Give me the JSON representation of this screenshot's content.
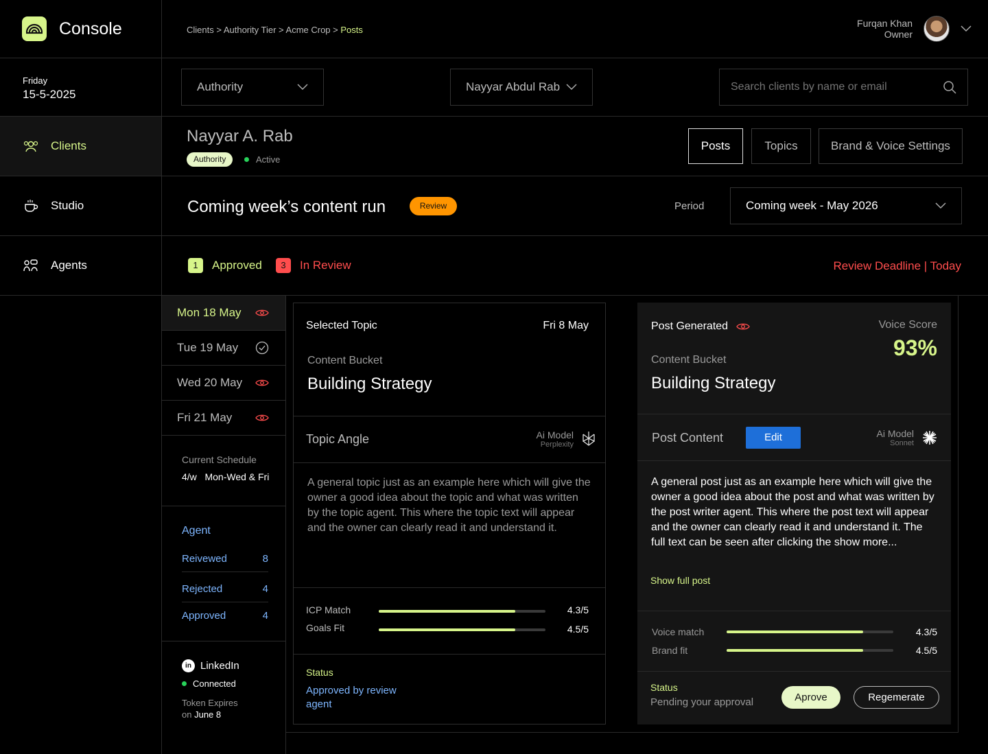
{
  "app": {
    "title": "Console"
  },
  "breadcrumb": {
    "path": "Clients > Authority Tier > Acme Crop  >",
    "current": "Posts"
  },
  "user": {
    "name": "Furqan Khan",
    "role": "Owner"
  },
  "date": {
    "day": "Friday",
    "date": "15-5-2025"
  },
  "nav": {
    "clients": "Clients",
    "studio": "Studio",
    "agents": "Agents"
  },
  "filters": {
    "tier": "Authority",
    "client": "Nayyar Abdul Rab",
    "search_placeholder": "Search clients by name or email"
  },
  "client": {
    "name": "Nayyar A. Rab",
    "tier_badge": "Authority",
    "status": "Active"
  },
  "tabs": {
    "posts": "Posts",
    "topics": "Topics",
    "brand": "Brand & Voice Settings"
  },
  "run": {
    "title": "Coming week’s content run",
    "badge": "Review",
    "period_label": "Period",
    "period_value": "Coming week - May 2026"
  },
  "counts": {
    "approved_num": "1",
    "approved_label": "Approved",
    "review_num": "3",
    "review_label": "In Review",
    "deadline": "Review Deadline | Today"
  },
  "days": [
    {
      "label": "Mon 18 May",
      "icon": "eye-icon"
    },
    {
      "label": "Tue 19 May",
      "icon": "check-circle-icon"
    },
    {
      "label": "Wed 20 May",
      "icon": "eye-icon"
    },
    {
      "label": "Fri 21 May",
      "icon": "eye-icon"
    }
  ],
  "schedule": {
    "label": "Current Schedule",
    "value": "4/w   Mon-Wed & Fri"
  },
  "agent": {
    "title": "Agent",
    "rows": [
      {
        "label": "Reivewed",
        "value": "8"
      },
      {
        "label": "Rejected",
        "value": "4"
      },
      {
        "label": "Approved",
        "value": "4"
      }
    ]
  },
  "linkedin": {
    "name": "LinkedIn",
    "status": "Connected",
    "token_line1": "Token Expires",
    "token_prefix": "on",
    "token_date": "June 8"
  },
  "topic_card": {
    "title": "Selected Topic",
    "date": "Fri 8 May",
    "bucket_label": "Content Bucket",
    "bucket": "Building Strategy",
    "angle_label": "Topic Angle",
    "model_label": "Ai Model",
    "model_name": "Perplexity",
    "text": "A general topic just as an example here which will give the owner a good idea about the topic and what was written by the topic agent. This where the topic text will appear and the owner can clearly read it and understand it.",
    "metrics": [
      {
        "label": "ICP Match",
        "value": "4.3/5",
        "fraction": 0.82
      },
      {
        "label": "Goals Fit",
        "value": "4.5/5",
        "fraction": 0.82
      }
    ],
    "status_label": "Status",
    "status_value": "Approved by review agent"
  },
  "post_card": {
    "title": "Post Generated",
    "score_label": "Voice Score",
    "score": "93%",
    "bucket_label": "Content Bucket",
    "bucket": "Building Strategy",
    "content_label": "Post Content",
    "edit": "Edit",
    "model_label": "Ai Model",
    "model_name": "Sonnet",
    "text": "A general post just as an example here which will give the owner a good idea about the post and what was written by the post writer agent. This where the post text will appear and the owner can clearly read it and understand it. The full text can be seen after clicking the show more...",
    "show_full": "Show full post",
    "metrics": [
      {
        "label": "Voice match",
        "value": "4.3/5",
        "fraction": 0.82
      },
      {
        "label": "Brand fit",
        "value": "4.5/5",
        "fraction": 0.82
      }
    ],
    "status_label": "Status",
    "status_value": "Pending your approval",
    "approve": "Aprove",
    "regenerate": "Regemerate"
  },
  "colors": {
    "accent": "#d7f58a",
    "danger": "#ff4d4d",
    "badge": "#ff9500",
    "edit": "#1e6fd9"
  }
}
